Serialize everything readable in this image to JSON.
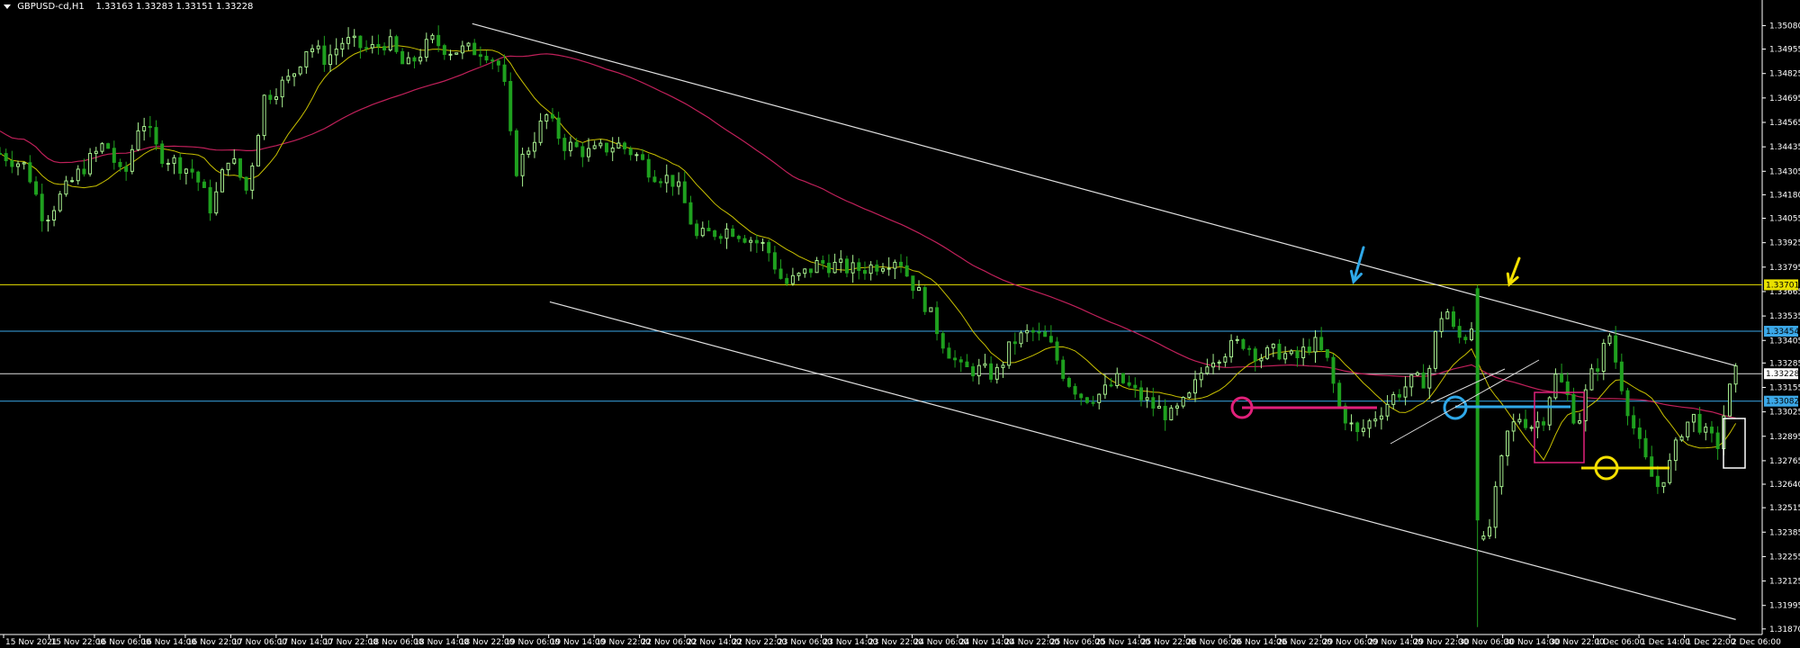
{
  "header": {
    "symbol_tf": "GBPUSD-cd,H1",
    "ohlc": "1.33163 1.33283 1.33151 1.33228"
  },
  "colors": {
    "background": "#000000",
    "bull_candle": "#A8F090",
    "bear_candle": "#1FA01F",
    "ma_fast": "#C8C000",
    "ma_slow": "#C0205A",
    "channel": "#E0E0E0",
    "level_yellow": "#E8E000",
    "level_blue": "#3BA8E8",
    "level_white": "#DDDDDD",
    "annotation_magenta": "#E0207A",
    "annotation_blue": "#2FA8E8",
    "annotation_yellow": "#F5E000",
    "axis_text": "#FFFFFF"
  },
  "chart_data": {
    "type": "candlestick",
    "symbol": "GBPUSD-cd",
    "timeframe": "H1",
    "ylim": [
      1.3185,
      1.3513
    ],
    "y_ticks": [
      "1.35080",
      "1.34955",
      "1.34825",
      "1.34695",
      "1.34565",
      "1.34435",
      "1.34305",
      "1.34180",
      "1.34055",
      "1.33925",
      "1.33795",
      "1.33665",
      "1.33535",
      "1.33405",
      "1.33285",
      "1.33155",
      "1.33025",
      "1.32895",
      "1.32765",
      "1.32640",
      "1.32515",
      "1.32385",
      "1.32255",
      "1.32125",
      "1.31995",
      "1.31870"
    ],
    "x_ticks": [
      "15 Nov 2021",
      "15 Nov 22:00",
      "16 Nov 06:00",
      "16 Nov 14:00",
      "16 Nov 22:00",
      "17 Nov 06:00",
      "17 Nov 14:00",
      "17 Nov 22:00",
      "18 Nov 06:00",
      "18 Nov 14:00",
      "18 Nov 22:00",
      "19 Nov 06:00",
      "19 Nov 14:00",
      "19 Nov 22:00",
      "22 Nov 06:00",
      "22 Nov 14:00",
      "22 Nov 22:00",
      "23 Nov 06:00",
      "23 Nov 14:00",
      "23 Nov 22:00",
      "24 Nov 06:00",
      "24 Nov 14:00",
      "24 Nov 22:00",
      "25 Nov 06:00",
      "25 Nov 14:00",
      "25 Nov 22:00",
      "26 Nov 06:00",
      "26 Nov 14:00",
      "26 Nov 22:00",
      "29 Nov 06:00",
      "29 Nov 14:00",
      "29 Nov 22:00",
      "30 Nov 06:00",
      "30 Nov 14:00",
      "30 Nov 22:00",
      "1 Dec 06:00",
      "1 Dec 14:00",
      "1 Dec 22:00",
      "2 Dec 06:00"
    ],
    "price_labels": [
      {
        "text": "1.33701",
        "price": 1.33701,
        "color": "#E8E000",
        "text_color": "#000000"
      },
      {
        "text": "1.33454",
        "price": 1.33454,
        "color": "#3BA8E8",
        "text_color": "#000000"
      },
      {
        "text": "1.33228",
        "price": 1.33228,
        "color": "#FFFFFF",
        "text_color": "#000000"
      },
      {
        "text": "1.33082",
        "price": 1.33082,
        "color": "#3BA8E8",
        "text_color": "#000000"
      }
    ],
    "levels": [
      {
        "price": 1.33701,
        "color": "#E8E000"
      },
      {
        "price": 1.33454,
        "color": "#3BA8E8"
      },
      {
        "price": 1.33228,
        "color": "#DDDDDD"
      },
      {
        "price": 1.33082,
        "color": "#3BA8E8"
      }
    ],
    "channel": {
      "upper": {
        "from": {
          "bar": 0.268,
          "price": 1.3509
        },
        "to": {
          "bar": 0.985,
          "price": 1.3327
        }
      },
      "lower": {
        "from": {
          "bar": 0.312,
          "price": 1.3361
        },
        "to": {
          "bar": 0.985,
          "price": 1.3192
        }
      }
    },
    "candles_path": [
      [
        0,
        1.344
      ],
      [
        0.015,
        1.3433
      ],
      [
        0.025,
        1.3405
      ],
      [
        0.035,
        1.3418
      ],
      [
        0.045,
        1.343
      ],
      [
        0.06,
        1.3446
      ],
      [
        0.07,
        1.3425
      ],
      [
        0.08,
        1.346
      ],
      [
        0.09,
        1.344
      ],
      [
        0.1,
        1.3435
      ],
      [
        0.11,
        1.343
      ],
      [
        0.12,
        1.341
      ],
      [
        0.13,
        1.344
      ],
      [
        0.14,
        1.342
      ],
      [
        0.15,
        1.347
      ],
      [
        0.165,
        1.348
      ],
      [
        0.175,
        1.3498
      ],
      [
        0.185,
        1.349
      ],
      [
        0.195,
        1.35
      ],
      [
        0.21,
        1.3495
      ],
      [
        0.22,
        1.35
      ],
      [
        0.23,
        1.3485
      ],
      [
        0.245,
        1.35
      ],
      [
        0.255,
        1.3495
      ],
      [
        0.265,
        1.3495
      ],
      [
        0.275,
        1.3495
      ],
      [
        0.285,
        1.3485
      ],
      [
        0.292,
        1.343
      ],
      [
        0.298,
        1.344
      ],
      [
        0.31,
        1.346
      ],
      [
        0.32,
        1.3445
      ],
      [
        0.335,
        1.344
      ],
      [
        0.35,
        1.3445
      ],
      [
        0.36,
        1.344
      ],
      [
        0.37,
        1.343
      ],
      [
        0.383,
        1.3425
      ],
      [
        0.39,
        1.341
      ],
      [
        0.395,
        1.3395
      ],
      [
        0.405,
        1.3398
      ],
      [
        0.415,
        1.34
      ],
      [
        0.425,
        1.3395
      ],
      [
        0.435,
        1.339
      ],
      [
        0.445,
        1.337
      ],
      [
        0.455,
        1.3375
      ],
      [
        0.465,
        1.3382
      ],
      [
        0.475,
        1.338
      ],
      [
        0.485,
        1.3378
      ],
      [
        0.495,
        1.338
      ],
      [
        0.5,
        1.3382
      ],
      [
        0.51,
        1.3385
      ],
      [
        0.515,
        1.3375
      ],
      [
        0.525,
        1.336
      ],
      [
        0.535,
        1.334
      ],
      [
        0.545,
        1.3325
      ],
      [
        0.555,
        1.3325
      ],
      [
        0.565,
        1.3322
      ],
      [
        0.575,
        1.334
      ],
      [
        0.585,
        1.3345
      ],
      [
        0.595,
        1.334
      ],
      [
        0.605,
        1.332
      ],
      [
        0.615,
        1.331
      ],
      [
        0.625,
        1.3312
      ],
      [
        0.635,
        1.332
      ],
      [
        0.645,
        1.3312
      ],
      [
        0.655,
        1.3305
      ],
      [
        0.665,
        1.33
      ],
      [
        0.675,
        1.331
      ],
      [
        0.685,
        1.333
      ],
      [
        0.695,
        1.3335
      ],
      [
        0.705,
        1.334
      ],
      [
        0.715,
        1.3332
      ],
      [
        0.725,
        1.3335
      ],
      [
        0.735,
        1.333
      ],
      [
        0.745,
        1.334
      ],
      [
        0.753,
        1.333
      ],
      [
        0.76,
        1.3305
      ],
      [
        0.77,
        1.329
      ],
      [
        0.78,
        1.33
      ],
      [
        0.79,
        1.331
      ],
      [
        0.8,
        1.3318
      ],
      [
        0.81,
        1.332
      ],
      [
        0.815,
        1.3345
      ],
      [
        0.82,
        1.336
      ],
      [
        0.825,
        1.3345
      ],
      [
        0.83,
        1.334
      ],
      [
        0.835,
        1.335
      ],
      [
        0.838,
        1.324
      ],
      [
        0.843,
        1.323
      ],
      [
        0.848,
        1.3255
      ],
      [
        0.855,
        1.329
      ],
      [
        0.862,
        1.33
      ],
      [
        0.87,
        1.3295
      ],
      [
        0.876,
        1.33
      ],
      [
        0.882,
        1.3322
      ],
      [
        0.888,
        1.3315
      ],
      [
        0.895,
        1.3295
      ],
      [
        0.902,
        1.332
      ],
      [
        0.908,
        1.333
      ],
      [
        0.913,
        1.3345
      ],
      [
        0.918,
        1.3325
      ],
      [
        0.925,
        1.33
      ],
      [
        0.932,
        1.328
      ],
      [
        0.94,
        1.3262
      ],
      [
        0.948,
        1.3275
      ],
      [
        0.955,
        1.3295
      ],
      [
        0.962,
        1.33
      ],
      [
        0.968,
        1.329
      ],
      [
        0.975,
        1.3285
      ],
      [
        0.98,
        1.331
      ],
      [
        0.985,
        1.3323
      ]
    ]
  }
}
